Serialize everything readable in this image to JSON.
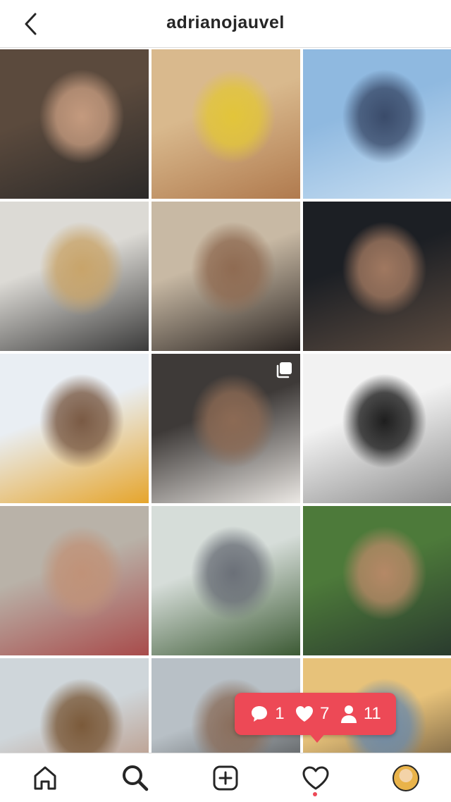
{
  "header": {
    "username": "adrianojauvel",
    "back_icon": "chevron-left-icon"
  },
  "grid": {
    "tiles": [
      {
        "name": "two-men-laughing",
        "colors": [
          "#5b4a3d",
          "#2c2a29",
          "#c49a7e"
        ]
      },
      {
        "name": "closeup-yellow-scarf",
        "colors": [
          "#d9b98d",
          "#b07a4e",
          "#e2c53a"
        ]
      },
      {
        "name": "man-on-balcony-sky",
        "colors": [
          "#8fb9e0",
          "#c9dff2",
          "#3a4b6a"
        ]
      },
      {
        "name": "balance-board-living-room",
        "colors": [
          "#dcdad5",
          "#3a3a3a",
          "#c8a46a"
        ]
      },
      {
        "name": "selfie-black-shirt",
        "colors": [
          "#c8b9a4",
          "#2b2522",
          "#8f6b52"
        ]
      },
      {
        "name": "portrait-dark-bg",
        "colors": [
          "#1c1f24",
          "#5b4b40",
          "#a07860"
        ]
      },
      {
        "name": "man-yellow-shirt",
        "colors": [
          "#e9eef3",
          "#e6a52c",
          "#7a5a44"
        ]
      },
      {
        "name": "portrait-white-tee",
        "colors": [
          "#3e3a38",
          "#ebe8e4",
          "#8c6a54"
        ],
        "multi": true
      },
      {
        "name": "bw-rooftop",
        "colors": [
          "#f2f2f2",
          "#8e8e8e",
          "#1e1e1e"
        ]
      },
      {
        "name": "towel-balcony",
        "colors": [
          "#b9b2a8",
          "#a84b4b",
          "#c09278"
        ]
      },
      {
        "name": "gardening-plants",
        "colors": [
          "#d6ddd9",
          "#3c5a34",
          "#6b7078"
        ]
      },
      {
        "name": "stream-forest",
        "colors": [
          "#4d7a3a",
          "#2a3b2e",
          "#b58866"
        ]
      },
      {
        "name": "shirtless-balcony",
        "colors": [
          "#cfd6da",
          "#b07d61",
          "#7b5a3a"
        ]
      },
      {
        "name": "hat-beard-portrait",
        "colors": [
          "#b8c0c6",
          "#2a2a2a",
          "#8a6e5c"
        ]
      },
      {
        "name": "sunset-terrace",
        "colors": [
          "#e7c27a",
          "#3e3026",
          "#6d8aa8"
        ]
      }
    ]
  },
  "toast": {
    "comments": "1",
    "likes": "7",
    "follows": "11",
    "color": "#ed4956"
  },
  "tabbar": {
    "items": [
      "home-icon",
      "search-icon",
      "new-post-icon",
      "activity-heart-icon",
      "profile-avatar"
    ]
  }
}
